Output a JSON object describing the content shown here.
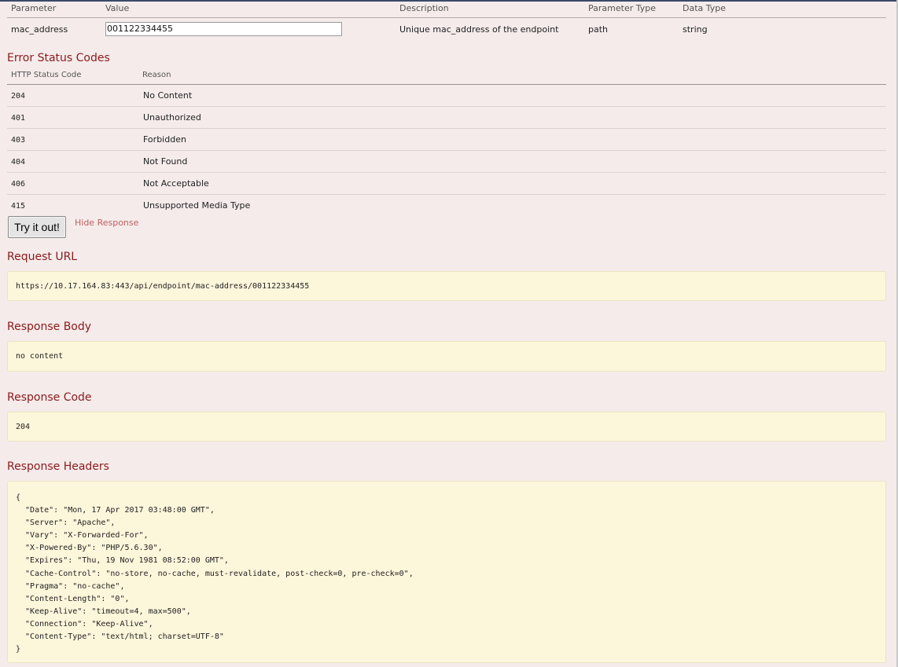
{
  "params": {
    "headers": [
      "Parameter",
      "Value",
      "Description",
      "Parameter Type",
      "Data Type"
    ],
    "row": {
      "name": "mac_address",
      "value": "001122334455",
      "description": "Unique mac_address of the endpoint",
      "param_type": "path",
      "data_type": "string"
    }
  },
  "error_codes": {
    "title": "Error Status Codes",
    "headers": [
      "HTTP Status Code",
      "Reason"
    ],
    "rows": [
      {
        "code": "204",
        "reason": "No Content"
      },
      {
        "code": "401",
        "reason": "Unauthorized"
      },
      {
        "code": "403",
        "reason": "Forbidden"
      },
      {
        "code": "404",
        "reason": "Not Found"
      },
      {
        "code": "406",
        "reason": "Not Acceptable"
      },
      {
        "code": "415",
        "reason": "Unsupported Media Type"
      }
    ]
  },
  "actions": {
    "try_label": "Try it out!",
    "hide_label": "Hide Response"
  },
  "request_url": {
    "title": "Request URL",
    "value": "https://10.17.164.83:443/api/endpoint/mac-address/001122334455"
  },
  "response_body": {
    "title": "Response Body",
    "value": "no content"
  },
  "response_code": {
    "title": "Response Code",
    "value": "204"
  },
  "response_headers": {
    "title": "Response Headers",
    "value": "{\n  \"Date\": \"Mon, 17 Apr 2017 03:48:00 GMT\",\n  \"Server\": \"Apache\",\n  \"Vary\": \"X-Forwarded-For\",\n  \"X-Powered-By\": \"PHP/5.6.30\",\n  \"Expires\": \"Thu, 19 Nov 1981 08:52:00 GMT\",\n  \"Cache-Control\": \"no-store, no-cache, must-revalidate, post-check=0, pre-check=0\",\n  \"Pragma\": \"no-cache\",\n  \"Content-Length\": \"0\",\n  \"Keep-Alive\": \"timeout=4, max=500\",\n  \"Connection\": \"Keep-Alive\",\n  \"Content-Type\": \"text/html; charset=UTF-8\"\n}"
  },
  "colors": {
    "background": "#f5ebeb",
    "section_title": "#8a1a1a",
    "code_box": "#fcf6db",
    "link": "#c06060"
  }
}
